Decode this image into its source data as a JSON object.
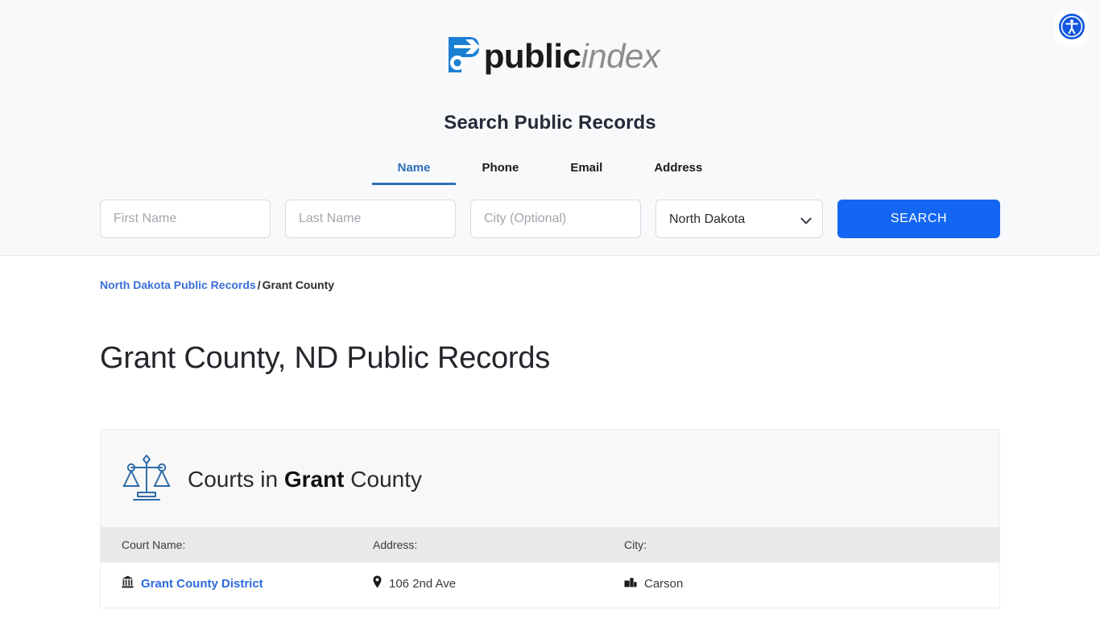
{
  "brand": {
    "logo_icon": "publicindex-p-arrow-logo",
    "name_bold": "public",
    "name_italic": "index",
    "accent_color": "#1266f1"
  },
  "accessibility": {
    "icon": "accessibility-person-icon",
    "label": "Accessibility"
  },
  "search": {
    "heading": "Search Public Records",
    "tabs": [
      {
        "label": "Name",
        "active": true
      },
      {
        "label": "Phone",
        "active": false
      },
      {
        "label": "Email",
        "active": false
      },
      {
        "label": "Address",
        "active": false
      }
    ],
    "first_name": {
      "placeholder": "First Name",
      "value": ""
    },
    "last_name": {
      "placeholder": "Last Name",
      "value": ""
    },
    "city": {
      "placeholder": "City (Optional)",
      "value": ""
    },
    "state": {
      "selected": "North Dakota",
      "chevron_icon": "chevron-down-icon"
    },
    "submit_label": "SEARCH"
  },
  "breadcrumb": {
    "parent_link": "North Dakota Public Records",
    "separator": "/",
    "current": "Grant County"
  },
  "page": {
    "title": "Grant County, ND Public Records"
  },
  "courts_panel": {
    "icon": "scales-of-justice-icon",
    "title_prefix": "Courts in",
    "title_bold": "Grant",
    "title_suffix": "County",
    "columns": {
      "name": "Court Name:",
      "address": "Address:",
      "city": "City:"
    },
    "rows": [
      {
        "name": "Grant County District",
        "name_icon": "courthouse-icon",
        "address": "106 2nd Ave",
        "address_icon": "map-pin-icon",
        "city": "Carson",
        "city_icon": "city-buildings-icon"
      }
    ]
  }
}
